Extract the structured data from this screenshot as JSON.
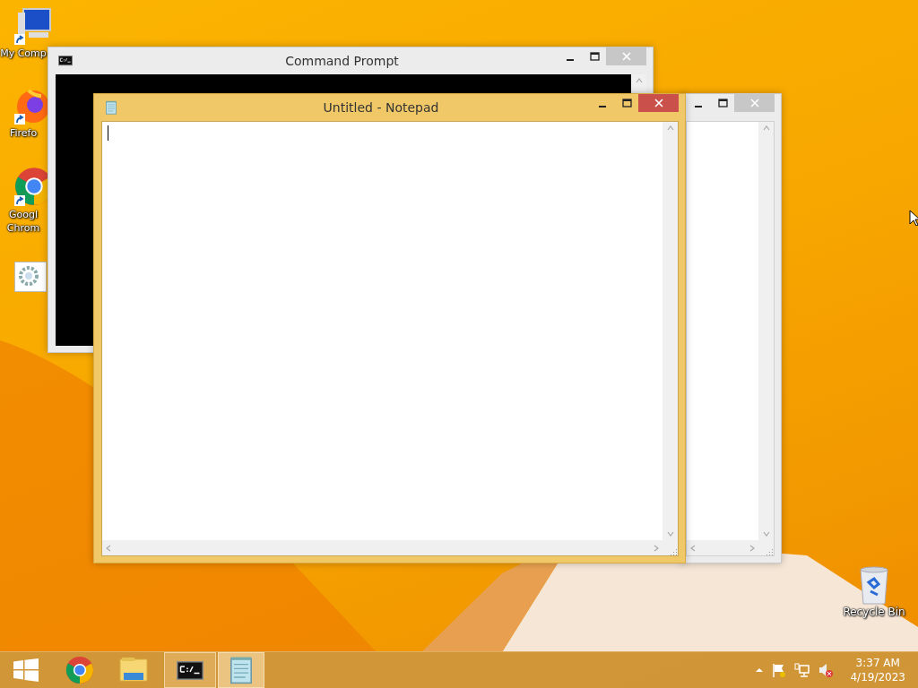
{
  "desktop_icons": [
    {
      "kind": "computer",
      "label_lines": [
        "My Comp"
      ]
    },
    {
      "kind": "firefox",
      "label_lines": [
        "Firefo"
      ]
    },
    {
      "kind": "chrome",
      "label_lines": [
        "Googl",
        "Chrom"
      ]
    },
    {
      "kind": "settings"
    }
  ],
  "recycle_bin": {
    "label_lines": [
      "Recycle Bin"
    ]
  },
  "windows": [
    {
      "kind": "console",
      "title": "Command Prompt",
      "active": false
    },
    {
      "kind": "blank",
      "active": false
    },
    {
      "kind": "notepad",
      "title": "Untitled - Notepad",
      "active": true
    }
  ],
  "taskbar": {
    "items": [
      {
        "kind": "start",
        "open": false,
        "selected": false
      },
      {
        "kind": "chrome",
        "open": false,
        "selected": false
      },
      {
        "kind": "explorer",
        "open": false,
        "selected": false
      },
      {
        "kind": "console",
        "open": true,
        "selected": false
      },
      {
        "kind": "notepad",
        "open": true,
        "selected": true
      }
    ],
    "tray": {
      "time": "3:37 AM",
      "date": "4/19/2023"
    }
  }
}
